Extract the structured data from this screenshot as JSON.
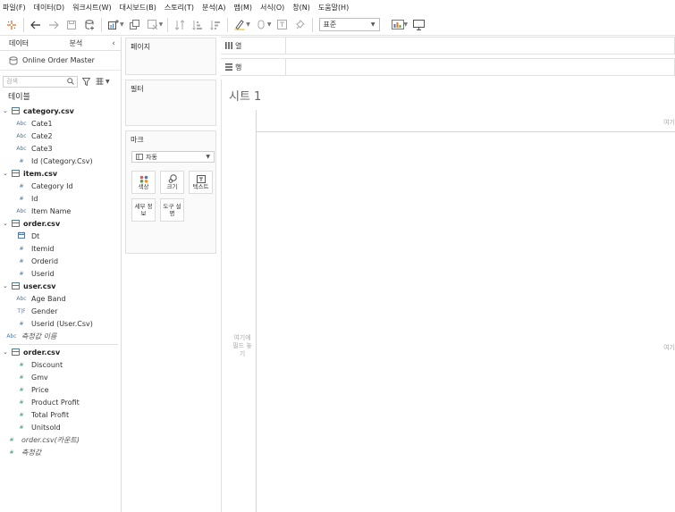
{
  "menu": [
    "파일(F)",
    "데이터(D)",
    "워크시트(W)",
    "대시보드(B)",
    "스토리(T)",
    "분석(A)",
    "맵(M)",
    "서식(O)",
    "창(N)",
    "도움말(H)"
  ],
  "toolbar": {
    "fit_value": "표준"
  },
  "datapane": {
    "tab_data": "데이터",
    "tab_analysis": "분석",
    "datasource_name": "Online Order Master",
    "search_placeholder": "검색",
    "tables_heading": "테이블",
    "tables": [
      {
        "name": "category.csv",
        "fields": [
          {
            "type": "Abc",
            "name": "Cate1"
          },
          {
            "type": "Abc",
            "name": "Cate2"
          },
          {
            "type": "Abc",
            "name": "Cate3"
          },
          {
            "type": "#",
            "name": "Id (Category.Csv)"
          }
        ]
      },
      {
        "name": "item.csv",
        "fields": [
          {
            "type": "#",
            "name": "Category Id"
          },
          {
            "type": "#",
            "name": "Id"
          },
          {
            "type": "Abc",
            "name": "Item Name"
          }
        ]
      },
      {
        "name": "order.csv",
        "fields": [
          {
            "type": "date",
            "name": "Dt"
          },
          {
            "type": "#",
            "name": "Itemid"
          },
          {
            "type": "#",
            "name": "Orderid"
          },
          {
            "type": "#",
            "name": "Userid"
          }
        ]
      },
      {
        "name": "user.csv",
        "fields": [
          {
            "type": "Abc",
            "name": "Age Band"
          },
          {
            "type": "T|F",
            "name": "Gender"
          },
          {
            "type": "#",
            "name": "Userid (User.Csv)"
          }
        ]
      }
    ],
    "measure_names": "측정값 이름",
    "measure_table": {
      "name": "order.csv",
      "fields": [
        {
          "type": "#",
          "name": "Discount"
        },
        {
          "type": "#",
          "name": "Gmv"
        },
        {
          "type": "#",
          "name": "Price"
        },
        {
          "type": "#",
          "name": "Product Profit"
        },
        {
          "type": "#",
          "name": "Total Profit"
        },
        {
          "type": "#",
          "name": "Unitsold"
        }
      ]
    },
    "count_field": "order.csv(카운트)",
    "measure_values": "측정값"
  },
  "shelves": {
    "pages": "페이지",
    "filters": "필터",
    "marks": "마크",
    "marks_type": "자동",
    "mark_buttons": [
      "색상",
      "크기",
      "텍스트",
      "세부 정보",
      "도구 설명"
    ],
    "columns": "열",
    "rows": "행"
  },
  "sheet": {
    "title": "시트 1",
    "drop_cols_hint": "여기",
    "drop_rows_hint": "여기에 필드 놓기",
    "drop_right_hint": "여기"
  },
  "colors": {
    "dimension": "#4e79a7",
    "measure": "#3d9a74"
  }
}
